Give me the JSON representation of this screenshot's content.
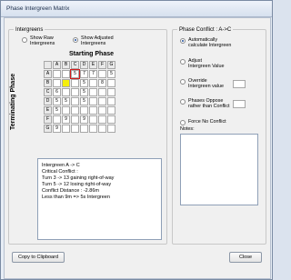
{
  "window": {
    "title": "Phase Intergreen Matrix"
  },
  "intergreens": {
    "group_label": "Intergreens",
    "show_raw_line1": "Show Raw",
    "show_raw_line2": "Intergreens",
    "show_adj_line1": "Show Adjusted",
    "show_adj_line2": "Intergreens",
    "selected": "adjusted"
  },
  "matrix": {
    "title": "Starting Phase",
    "row_axis_label": "Terminating Phase",
    "columns": [
      "A",
      "B",
      "C",
      "D",
      "E",
      "F",
      "G"
    ],
    "rows": [
      {
        "label": "A",
        "values": [
          "",
          "",
          "5",
          "7",
          "7",
          "",
          "5"
        ]
      },
      {
        "label": "B",
        "values": [
          "",
          "",
          "",
          "5",
          "",
          "8",
          ""
        ]
      },
      {
        "label": "C",
        "values": [
          "6",
          "",
          "",
          "5",
          "",
          "",
          ""
        ]
      },
      {
        "label": "D",
        "values": [
          "5",
          "5",
          "",
          "5",
          "",
          "",
          ""
        ]
      },
      {
        "label": "E",
        "values": [
          "5",
          "",
          "",
          "",
          "",
          "",
          ""
        ]
      },
      {
        "label": "F",
        "values": [
          "",
          "9",
          "",
          "9",
          "",
          "",
          ""
        ]
      },
      {
        "label": "G",
        "values": [
          "9",
          "",
          "",
          "",
          "",
          "",
          ""
        ]
      }
    ]
  },
  "info": {
    "lines": [
      "Intergreen A -> C",
      "Critical Conflict :",
      "Turn 3 -> 13 gaining right-of-way",
      "Turn 5 -> 12 losing right-of-way",
      "Conflict Distance : -2.86m",
      "Less than 9m => 5s Intergreen"
    ]
  },
  "phase_conflict": {
    "group_label": "Phase Conflict : A->C",
    "options": [
      {
        "line1": "Automatically",
        "line2": "calculate Intergreen",
        "checked": true
      },
      {
        "line1": "Adjust",
        "line2": "Intergreen Value",
        "checked": false
      },
      {
        "line1": "Override",
        "line2": "Intergreen value",
        "checked": false
      },
      {
        "line1": "Phases Oppose",
        "line2": "rather than Conflict",
        "checked": false
      },
      {
        "line1": "Force No Conflict",
        "line2": "",
        "checked": false
      }
    ],
    "notes_label": "Notes:"
  },
  "buttons": {
    "copy": "Copy to Clipboard",
    "close": "Close"
  }
}
